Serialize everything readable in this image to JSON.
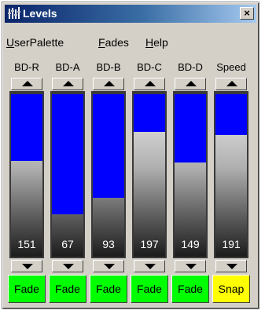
{
  "window": {
    "title": "Levels",
    "close_glyph": "×"
  },
  "menu": [
    {
      "label": "UserPalette",
      "mnemonic": "U",
      "rest": "serPalette"
    },
    {
      "label": "Fades",
      "mnemonic": "F",
      "rest": "ades"
    },
    {
      "label": "Help",
      "mnemonic": "H",
      "rest": "elp"
    }
  ],
  "channels": [
    {
      "label": "BD-R",
      "value": "151",
      "level": 0.59,
      "mode": "Fade",
      "mode_color": "#00ff00"
    },
    {
      "label": "BD-A",
      "value": "67",
      "level": 0.26,
      "mode": "Fade",
      "mode_color": "#00ff00"
    },
    {
      "label": "BD-B",
      "value": "93",
      "level": 0.36,
      "mode": "Fade",
      "mode_color": "#00ff00"
    },
    {
      "label": "BD-C",
      "value": "197",
      "level": 0.77,
      "mode": "Fade",
      "mode_color": "#00ff00"
    },
    {
      "label": "BD-D",
      "value": "149",
      "level": 0.58,
      "mode": "Fade",
      "mode_color": "#00ff00"
    },
    {
      "label": "Speed",
      "value": "191",
      "level": 0.75,
      "mode": "Snap",
      "mode_color": "#ffff00"
    }
  ],
  "colors": {
    "level_fill": "#0000ff",
    "window_bg": "#d4d0c8"
  },
  "icons": {
    "app": "levels-app-icon",
    "up": "triangle-up-icon",
    "down": "triangle-down-icon"
  }
}
